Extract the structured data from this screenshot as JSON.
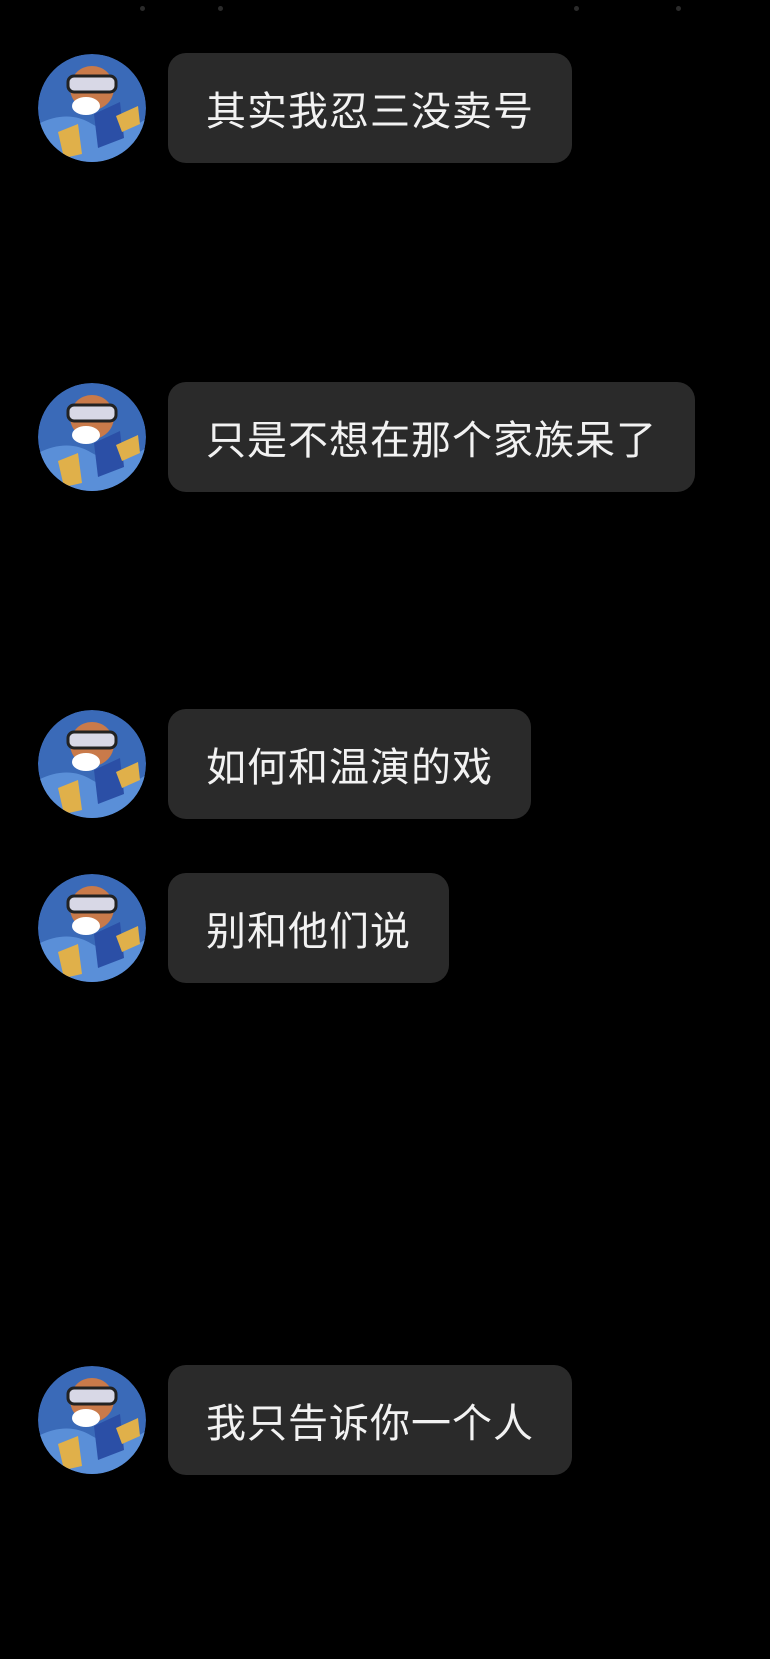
{
  "conversation": {
    "messages": [
      {
        "sender": "avatar",
        "text": "其实我忍三没卖号"
      },
      {
        "sender": "avatar",
        "text": "只是不想在那个家族呆了"
      },
      {
        "sender": "avatar",
        "text": "如何和温演的戏"
      },
      {
        "sender": "avatar",
        "text": "别和他们说"
      },
      {
        "sender": "avatar",
        "text": "我只告诉你一个人"
      }
    ]
  },
  "colors": {
    "background": "#000000",
    "bubble": "#2a2a2a",
    "text": "#f2f2f2",
    "avatar_bg": "#3a6ab8",
    "avatar_accent": "#e0b04a"
  }
}
